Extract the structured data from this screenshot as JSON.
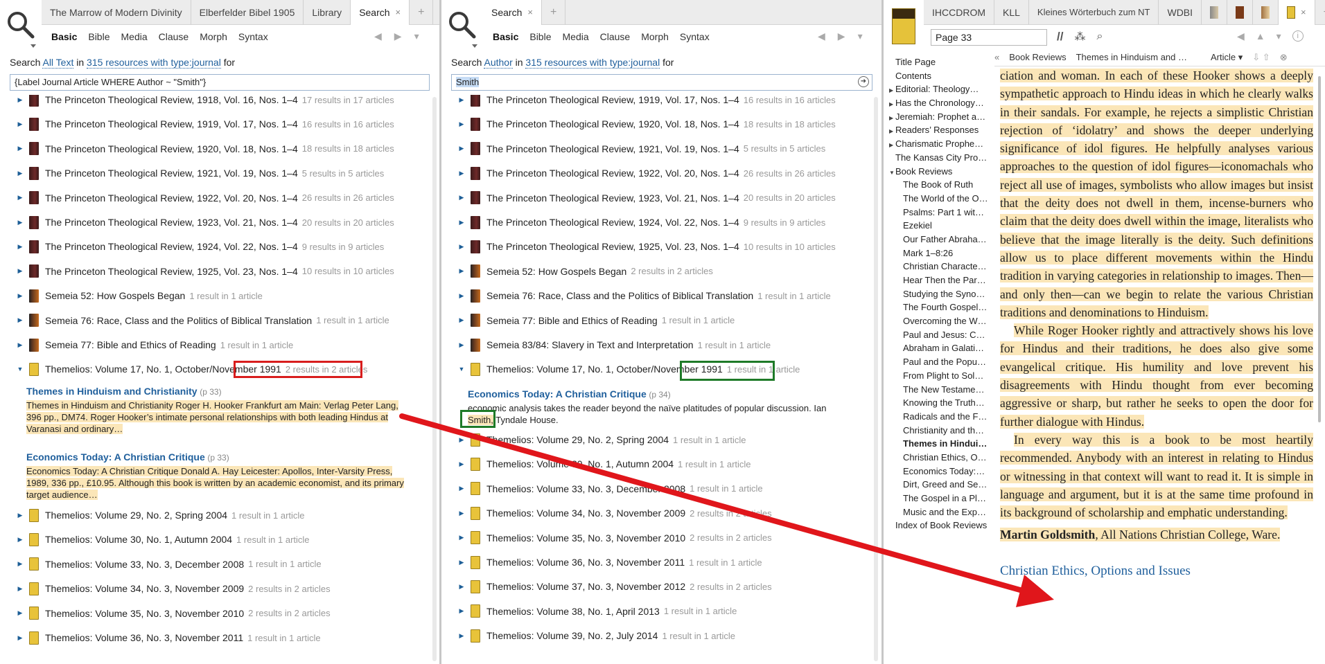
{
  "panel1": {
    "tabs": [
      {
        "label": "The Marrow of Modern Divinity"
      },
      {
        "label": "Elberfelder Bibel 1905"
      },
      {
        "label": "Library"
      },
      {
        "label": "Search"
      }
    ],
    "close_icon": "×",
    "add_tab_icon": "+",
    "kinds": [
      "Basic",
      "Bible",
      "Media",
      "Clause",
      "Morph",
      "Syntax"
    ],
    "search_label": {
      "prefix": "Search",
      "scope": "All Text",
      "in": "in",
      "resources": "315 resources with type:journal",
      "for": "for"
    },
    "query": "{Label Journal Article WHERE Author ~ \"Smith\"}",
    "results_top": [
      {
        "title": "The Princeton Theological Review, 1918, Vol. 16, Nos. 1–4",
        "count": "17 results in 17 articles",
        "icon": "pr"
      },
      {
        "title": "The Princeton Theological Review, 1919, Vol. 17, Nos. 1–4",
        "count": "16 results in 16 articles",
        "icon": "pr"
      },
      {
        "title": "The Princeton Theological Review, 1920, Vol. 18, Nos. 1–4",
        "count": "18 results in 18 articles",
        "icon": "pr"
      },
      {
        "title": "The Princeton Theological Review, 1921, Vol. 19, Nos. 1–4",
        "count": "5 results in 5 articles",
        "icon": "pr"
      },
      {
        "title": "The Princeton Theological Review, 1922, Vol. 20, Nos. 1–4",
        "count": "26 results in 26 articles",
        "icon": "pr"
      },
      {
        "title": "The Princeton Theological Review, 1923, Vol. 21, Nos. 1–4",
        "count": "20 results in 20 articles",
        "icon": "pr"
      },
      {
        "title": "The Princeton Theological Review, 1924, Vol. 22, Nos. 1–4",
        "count": "9 results in 9 articles",
        "icon": "pr"
      },
      {
        "title": "The Princeton Theological Review, 1925, Vol. 23, Nos. 1–4",
        "count": "10 results in 10 articles",
        "icon": "pr"
      },
      {
        "title": "Semeia 52: How Gospels Began",
        "count": "1 result in 1 article",
        "icon": "se"
      },
      {
        "title": "Semeia 76: Race, Class and the Politics of Biblical Translation",
        "count": "1 result in 1 article",
        "icon": "se"
      },
      {
        "title": "Semeia 77: Bible and Ethics of Reading",
        "count": "1 result in 1 article",
        "icon": "se"
      },
      {
        "title": "Themelios: Volume 17, No. 1, October/November 1991",
        "count": "2 results in 2 articles",
        "icon": "th",
        "expanded": true
      }
    ],
    "articles": [
      {
        "title": "Themes in Hinduism and Christianity",
        "page": "(p 33)",
        "snippet": "Themes in Hinduism and Christianity Roger H. Hooker Frankfurt am Main: Verlag Peter Lang, 396 pp., DM74. Roger Hooker’s intimate personal relationships with both leading Hindus at Varanasi and ordinary…"
      },
      {
        "title": "Economics Today: A Christian Critique",
        "page": "(p 33)",
        "snippet": "Economics Today: A Christian Critique Donald A. Hay Leicester: Apollos, Inter-Varsity Press, 1989, 336 pp., £10.95. Although this book is written by an academic economist, and its primary target audience…"
      }
    ],
    "results_bottom": [
      {
        "title": "Themelios: Volume 29, No. 2, Spring 2004",
        "count": "1 result in 1 article"
      },
      {
        "title": "Themelios: Volume 30, No. 1, Autumn 2004",
        "count": "1 result in 1 article"
      },
      {
        "title": "Themelios: Volume 33, No. 3, December 2008",
        "count": "1 result in 1 article"
      },
      {
        "title": "Themelios: Volume 34, No. 3, November 2009",
        "count": "2 results in 2 articles"
      },
      {
        "title": "Themelios: Volume 35, No. 3, November 2010",
        "count": "2 results in 2 articles"
      },
      {
        "title": "Themelios: Volume 36, No. 3, November 2011",
        "count": "1 result in 1 article"
      }
    ]
  },
  "panel2": {
    "tabs": [
      {
        "label": "Search"
      }
    ],
    "close_icon": "×",
    "add_tab_icon": "+",
    "kinds": [
      "Basic",
      "Bible",
      "Media",
      "Clause",
      "Morph",
      "Syntax"
    ],
    "search_label": {
      "prefix": "Search",
      "scope": "Author",
      "in": "in",
      "resources": "315 resources with type:journal",
      "for": "for"
    },
    "query": "Smith",
    "results_top": [
      {
        "title": "The Princeton Theological Review, 1919, Vol. 17, Nos. 1–4",
        "count": "16 results in 16 articles",
        "icon": "pr"
      },
      {
        "title": "The Princeton Theological Review, 1920, Vol. 18, Nos. 1–4",
        "count": "18 results in 18 articles",
        "icon": "pr"
      },
      {
        "title": "The Princeton Theological Review, 1921, Vol. 19, Nos. 1–4",
        "count": "5 results in 5 articles",
        "icon": "pr"
      },
      {
        "title": "The Princeton Theological Review, 1922, Vol. 20, Nos. 1–4",
        "count": "26 results in 26 articles",
        "icon": "pr"
      },
      {
        "title": "The Princeton Theological Review, 1923, Vol. 21, Nos. 1–4",
        "count": "20 results in 20 articles",
        "icon": "pr"
      },
      {
        "title": "The Princeton Theological Review, 1924, Vol. 22, Nos. 1–4",
        "count": "9 results in 9 articles",
        "icon": "pr"
      },
      {
        "title": "The Princeton Theological Review, 1925, Vol. 23, Nos. 1–4",
        "count": "10 results in 10 articles",
        "icon": "pr"
      },
      {
        "title": "Semeia 52: How Gospels Began",
        "count": "2 results in 2 articles",
        "icon": "se"
      },
      {
        "title": "Semeia 76: Race, Class and the Politics of Biblical Translation",
        "count": "1 result in 1 article",
        "icon": "se"
      },
      {
        "title": "Semeia 77: Bible and Ethics of Reading",
        "count": "1 result in 1 article",
        "icon": "se"
      },
      {
        "title": "Semeia 83/84: Slavery in Text and Interpretation",
        "count": "1 result in 1 article",
        "icon": "se"
      },
      {
        "title": "Themelios: Volume 17, No. 1, October/November 1991",
        "count": "1 result in 1 article",
        "icon": "th",
        "expanded": true
      }
    ],
    "article": {
      "title": "Economics Today: A Christian Critique",
      "page": "(p 34)",
      "snippet1": "economic analysis takes the reader beyond the naïve platitudes of popular discussion. Ian",
      "highlight": "Smith,",
      "snippet2": " Tyndale House."
    },
    "results_bottom": [
      {
        "title": "Themelios: Volume 29, No. 2, Spring 2004",
        "count": "1 result in 1 article"
      },
      {
        "title": "Themelios: Volume 30, No. 1, Autumn 2004",
        "count": "1 result in 1 article"
      },
      {
        "title": "Themelios: Volume 33, No. 3, December 2008",
        "count": "1 result in 1 article"
      },
      {
        "title": "Themelios: Volume 34, No. 3, November 2009",
        "count": "2 results in 2 articles"
      },
      {
        "title": "Themelios: Volume 35, No. 3, November 2010",
        "count": "2 results in 2 articles"
      },
      {
        "title": "Themelios: Volume 36, No. 3, November 2011",
        "count": "1 result in 1 article"
      },
      {
        "title": "Themelios: Volume 37, No. 3, November 2012",
        "count": "2 results in 2 articles"
      },
      {
        "title": "Themelios: Volume 38, No. 1, April 2013",
        "count": "1 result in 1 article"
      },
      {
        "title": "Themelios: Volume 39, No. 2, July 2014",
        "count": "1 result in 1 article"
      }
    ]
  },
  "panel3": {
    "tabs": [
      {
        "label": "IHCCDROM"
      },
      {
        "label": "KLL"
      },
      {
        "label": "Kleines Wörterbuch zum NT"
      },
      {
        "label": "WDBI"
      }
    ],
    "add_tab_icon": "+",
    "page_box": "Page 33",
    "toolbar_icons": [
      "//",
      "⁂",
      "⌕"
    ],
    "trail": {
      "back": "«",
      "crumb1": "Book Reviews",
      "crumb2": "Themes in Hinduism and …",
      "view": "Article ▾"
    },
    "toc": [
      {
        "label": "Title Page",
        "indent": false,
        "bold": false,
        "tri": ""
      },
      {
        "label": "Contents",
        "indent": false,
        "bold": false,
        "tri": ""
      },
      {
        "label": "Editorial: Theology…",
        "indent": false,
        "bold": false,
        "tri": "▶"
      },
      {
        "label": "Has the Chronology…",
        "indent": false,
        "bold": false,
        "tri": "▶"
      },
      {
        "label": "Jeremiah: Prophet a…",
        "indent": false,
        "bold": false,
        "tri": "▶"
      },
      {
        "label": "Readers’ Responses",
        "indent": false,
        "bold": false,
        "tri": "▶"
      },
      {
        "label": "Charismatic Prophe…",
        "indent": false,
        "bold": false,
        "tri": "▶"
      },
      {
        "label": "The Kansas City Pro…",
        "indent": false,
        "bold": false,
        "tri": ""
      },
      {
        "label": "Book Reviews",
        "indent": false,
        "bold": false,
        "tri": "▼"
      },
      {
        "label": "The Book of Ruth",
        "indent": true,
        "bold": false,
        "tri": ""
      },
      {
        "label": "The World of the O…",
        "indent": true,
        "bold": false,
        "tri": ""
      },
      {
        "label": "Psalms: Part 1 wit…",
        "indent": true,
        "bold": false,
        "tri": ""
      },
      {
        "label": "Ezekiel",
        "indent": true,
        "bold": false,
        "tri": ""
      },
      {
        "label": "Our Father Abraha…",
        "indent": true,
        "bold": false,
        "tri": ""
      },
      {
        "label": "Mark 1–8:26",
        "indent": true,
        "bold": false,
        "tri": ""
      },
      {
        "label": "Christian Characte…",
        "indent": true,
        "bold": false,
        "tri": ""
      },
      {
        "label": "Hear Then the Par…",
        "indent": true,
        "bold": false,
        "tri": ""
      },
      {
        "label": "Studying the Syno…",
        "indent": true,
        "bold": false,
        "tri": ""
      },
      {
        "label": "The Fourth Gospel…",
        "indent": true,
        "bold": false,
        "tri": ""
      },
      {
        "label": "Overcoming the W…",
        "indent": true,
        "bold": false,
        "tri": ""
      },
      {
        "label": "Paul and Jesus: C…",
        "indent": true,
        "bold": false,
        "tri": ""
      },
      {
        "label": "Abraham in Galati…",
        "indent": true,
        "bold": false,
        "tri": ""
      },
      {
        "label": "Paul and the Popu…",
        "indent": true,
        "bold": false,
        "tri": ""
      },
      {
        "label": "From Plight to Sol…",
        "indent": true,
        "bold": false,
        "tri": ""
      },
      {
        "label": "The New Testame…",
        "indent": true,
        "bold": false,
        "tri": ""
      },
      {
        "label": "Knowing the Truth…",
        "indent": true,
        "bold": false,
        "tri": ""
      },
      {
        "label": "Radicals and the F…",
        "indent": true,
        "bold": false,
        "tri": ""
      },
      {
        "label": "Christianity and th…",
        "indent": true,
        "bold": false,
        "tri": ""
      },
      {
        "label": "Themes in Hindui…",
        "indent": true,
        "bold": true,
        "tri": ""
      },
      {
        "label": "Christian Ethics, O…",
        "indent": true,
        "bold": false,
        "tri": ""
      },
      {
        "label": "Economics Today:…",
        "indent": true,
        "bold": false,
        "tri": ""
      },
      {
        "label": "Dirt, Greed and Se…",
        "indent": true,
        "bold": false,
        "tri": ""
      },
      {
        "label": "The Gospel in a Pl…",
        "indent": true,
        "bold": false,
        "tri": ""
      },
      {
        "label": "Music and the Exp…",
        "indent": true,
        "bold": false,
        "tri": ""
      },
      {
        "label": "Index of Book Reviews",
        "indent": false,
        "bold": false,
        "tri": ""
      }
    ],
    "reader": {
      "para1": "ciation and woman. In each of these Hooker shows a deeply sympathetic approach to Hindu ideas in which he clearly walks in their sandals. For example, he rejects a simplistic Christian rejection of ‘idolatry’ and shows the deeper underlying significance of idol figures. He helpfully analyses various approaches to the question of idol figures—iconomachals who reject all use of images, symbolists who allow images but insist that the deity does not dwell in them, incense-burners who claim that the deity does dwell within the image, literalists who believe that the image literally is the deity. Such definitions allow us to place different movements within the Hindu tradition in varying categories in relationship to images. Then—and only then—can we begin to relate the various Christian traditions and denominations to Hinduism.",
      "para2": "While Roger Hooker rightly and attractively shows his love for Hindus and their traditions, he does also give some evangelical critique. His humility and love prevent his disagreements with Hindu thought from ever becoming aggressive or sharp, but rather he seeks to open the door for further dialogue with Hindus.",
      "para3": "In every way this is a book to be most heartily recommended. Anybody with an interest in relating to Hindus or witnessing in that context will want to read it. It is simple in language and argument, but it is at the same time profound in its background of scholarship and emphatic understanding.",
      "author": "Martin Goldsmith",
      "affiliation": ", All Nations Christian College, Ware.",
      "next_title": "Christian Ethics, Options and Issues"
    }
  },
  "colors": {
    "red_box": "#d81d1d",
    "green_box": "#1e7a28",
    "arrow": "#e0161b",
    "highlight": "#fbe6b8",
    "link": "#1f5f9c"
  }
}
